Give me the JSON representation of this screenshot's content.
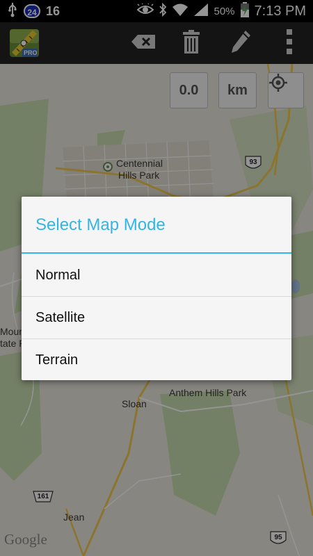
{
  "status_bar": {
    "notification_count": "16",
    "badge": "24",
    "battery_percent": "50%",
    "time": "7:13 PM",
    "icons": [
      "usb-icon",
      "eye-icon",
      "bluetooth-icon",
      "wifi-icon",
      "signal-icon",
      "battery-charging-icon"
    ]
  },
  "action_bar": {
    "app_icon_label": "PRO",
    "actions": [
      "backspace-icon",
      "trash-icon",
      "pencil-icon",
      "overflow-menu-icon"
    ]
  },
  "map": {
    "distance_value": "0.0",
    "unit_label": "km",
    "labels": {
      "centennial": "Centennial",
      "hills_park": "Hills Park",
      "anthem": "Anthem Hills Park",
      "sloan": "Sloan",
      "jean": "Jean",
      "mount": "Moun",
      "state_park": "tate Pa",
      "route_93": "93",
      "route_161": "161",
      "route_95": "95"
    },
    "attribution": "Google"
  },
  "dialog": {
    "title": "Select Map Mode",
    "options": [
      "Normal",
      "Satellite",
      "Terrain"
    ]
  }
}
